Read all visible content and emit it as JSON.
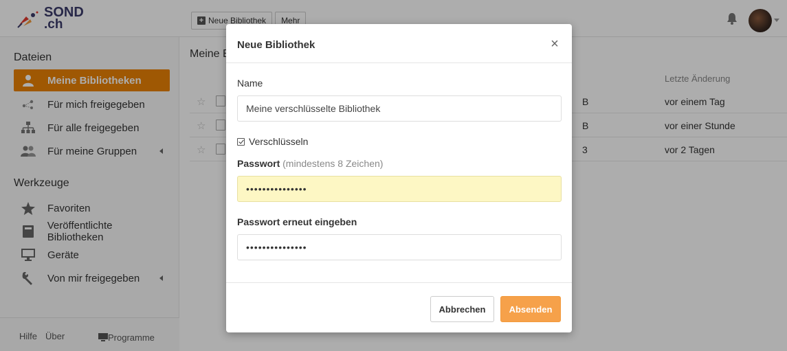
{
  "brand": {
    "line1": "SOND",
    "line2": ".ch"
  },
  "toolbar": {
    "new_library": "Neue Bibliothek",
    "more": "Mehr"
  },
  "sidebar": {
    "files_heading": "Dateien",
    "file_items": [
      {
        "label": "Meine Bibliotheken",
        "icon": "user-icon",
        "active": true
      },
      {
        "label": "Für mich freigegeben",
        "icon": "share-icon"
      },
      {
        "label": "Für alle freigegeben",
        "icon": "org-chart-icon"
      },
      {
        "label": "Für meine Gruppen",
        "icon": "group-icon"
      }
    ],
    "tools_heading": "Werkzeuge",
    "tool_items": [
      {
        "label": "Favoriten",
        "icon": "star-icon"
      },
      {
        "label": "Veröffentlichte Bibliotheken",
        "icon": "book-icon"
      },
      {
        "label": "Geräte",
        "icon": "monitor-icon"
      },
      {
        "label": "Von mir freigegeben",
        "icon": "wrench-icon"
      }
    ],
    "footer": {
      "help": "Hilfe",
      "about": "Über",
      "programs": "Programme"
    }
  },
  "main": {
    "title": "Meine B",
    "columns": {
      "last_modified": "Letzte Änderung"
    },
    "rows": [
      {
        "size_tail": "B",
        "modified": "vor einem Tag"
      },
      {
        "size_tail": "B",
        "modified": "vor einer Stunde"
      },
      {
        "size_tail": "3",
        "modified": "vor 2 Tagen"
      }
    ]
  },
  "modal": {
    "title": "Neue Bibliothek",
    "close_glyph": "×",
    "name_label": "Name",
    "name_value": "Meine verschlüsselte Bibliothek",
    "encrypt_label": "Verschlüsseln",
    "encrypt_checked": true,
    "password_label": "Passwort",
    "password_hint": "(mindestens 8 Zeichen)",
    "password_mask": "•••••••••••••••",
    "repeat_label": "Passwort erneut eingeben",
    "repeat_mask": "•••••••••••••••",
    "cancel": "Abbrechen",
    "submit": "Absenden"
  },
  "colors": {
    "accent": "#eb8205",
    "submit": "#f6a14a",
    "focus_bg": "#fdf7c4"
  }
}
